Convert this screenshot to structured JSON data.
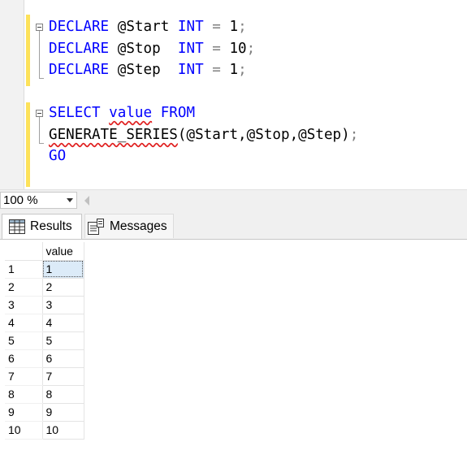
{
  "editor": {
    "line1": {
      "kw1": "DECLARE",
      "var": "@Start",
      "kw2": "INT",
      "op": "=",
      "num": "1",
      "end": ";"
    },
    "line2": {
      "kw1": "DECLARE",
      "var": "@Stop",
      "kw2": "INT",
      "op": "=",
      "num": "10",
      "end": ";"
    },
    "line3": {
      "kw1": "DECLARE",
      "var": "@Step",
      "kw2": "INT",
      "op": "=",
      "num": "1",
      "end": ";"
    },
    "line5": {
      "kw1": "SELECT",
      "col": "value",
      "kw2": "FROM"
    },
    "line6": {
      "fn": "GENERATE_SERIES",
      "args": "(@Start,@Stop,@Step)",
      "end": ";"
    },
    "line7": {
      "kw": "GO"
    }
  },
  "zoom": {
    "value": "100 %"
  },
  "tabs": {
    "results": "Results",
    "messages": "Messages"
  },
  "grid": {
    "header": "value",
    "rows": [
      {
        "num": "1",
        "value": "1"
      },
      {
        "num": "2",
        "value": "2"
      },
      {
        "num": "3",
        "value": "3"
      },
      {
        "num": "4",
        "value": "4"
      },
      {
        "num": "5",
        "value": "5"
      },
      {
        "num": "6",
        "value": "6"
      },
      {
        "num": "7",
        "value": "7"
      },
      {
        "num": "8",
        "value": "8"
      },
      {
        "num": "9",
        "value": "9"
      },
      {
        "num": "10",
        "value": "10"
      }
    ]
  }
}
